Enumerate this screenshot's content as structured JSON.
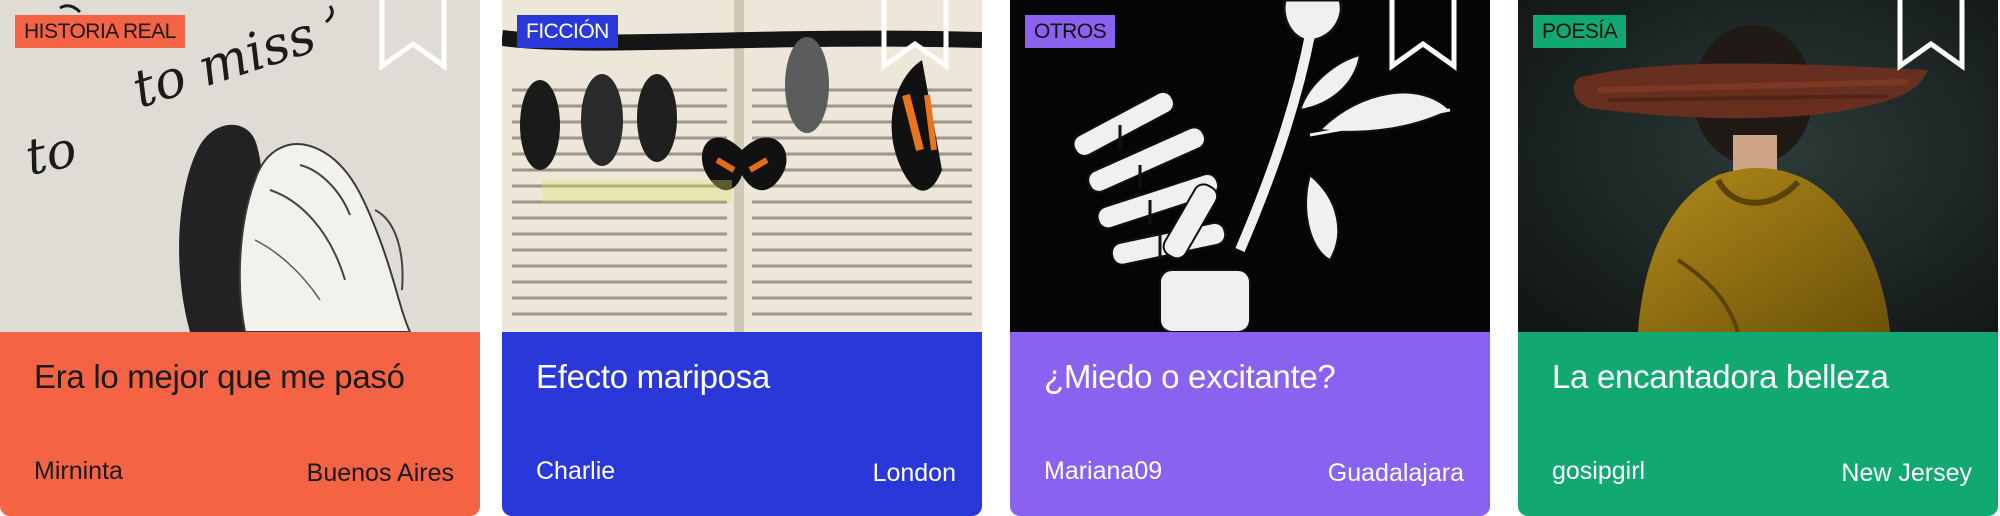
{
  "cards": [
    {
      "tag": "HISTORIA REAL",
      "title": "Era lo mejor que me pasó",
      "author": "Mirninta",
      "city": "Buenos Aires",
      "image_handwriting": [
        "to miss",
        "to"
      ],
      "colors": {
        "bottom": "#f46343",
        "tag_bg": "#f46343",
        "text": "#1a1a1a"
      }
    },
    {
      "tag": "FICCIÓN",
      "title": "Efecto mariposa",
      "author": "Charlie",
      "city": "London",
      "colors": {
        "bottom": "#2a38d9",
        "tag_bg": "#2a38d9",
        "text": "#ffffff"
      }
    },
    {
      "tag": "OTROS",
      "title": "¿Miedo o excitante?",
      "author": "Mariana09",
      "city": "Guadalajara",
      "colors": {
        "bottom": "#8a62f0",
        "tag_bg": "#8a62f0",
        "text": "#ffffff"
      }
    },
    {
      "tag": "POESÍA",
      "title": "La encantadora belleza",
      "author": "gosipgirl",
      "city": "New Jersey",
      "colors": {
        "bottom": "#12a872",
        "tag_bg": "#12a872",
        "text": "#ffffff"
      }
    }
  ],
  "icons": {
    "bookmark": "bookmark-icon"
  }
}
